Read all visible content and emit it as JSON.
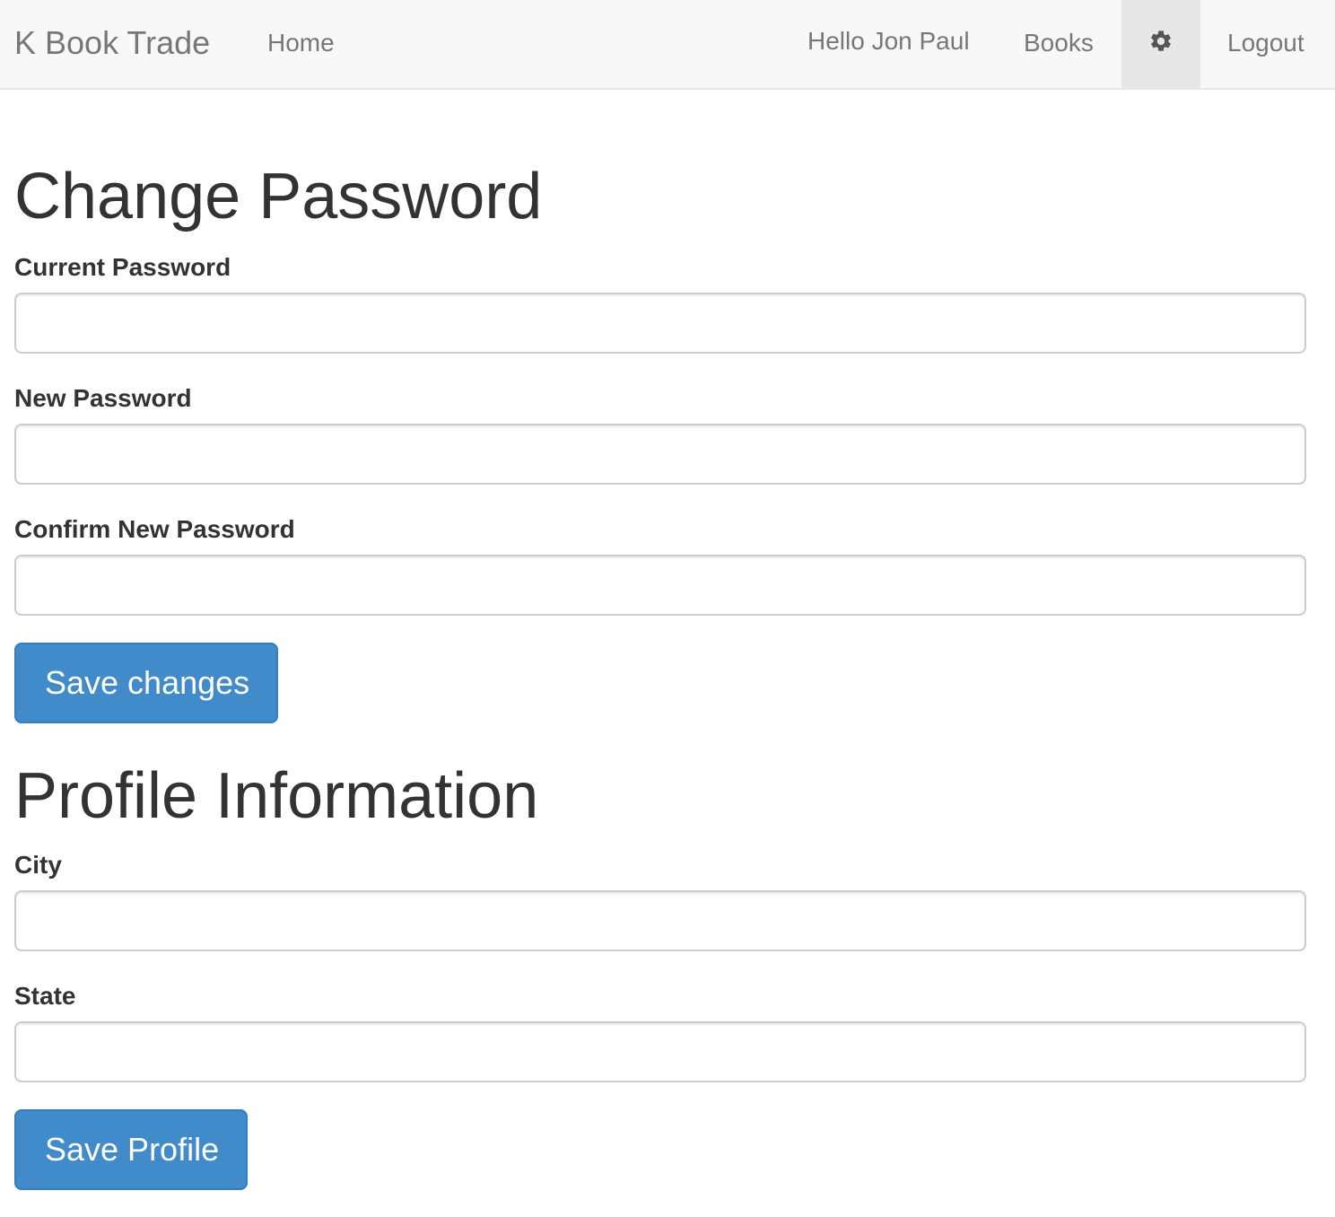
{
  "navbar": {
    "brand": "K Book Trade",
    "home": "Home",
    "greeting": "Hello Jon Paul",
    "books": "Books",
    "settings_icon": "gear-icon",
    "logout": "Logout"
  },
  "password_section": {
    "title": "Change Password",
    "current_label": "Current Password",
    "current_value": "",
    "new_label": "New Password",
    "new_value": "",
    "confirm_label": "Confirm New Password",
    "confirm_value": "",
    "save_label": "Save changes"
  },
  "profile_section": {
    "title": "Profile Information",
    "city_label": "City",
    "city_value": "",
    "state_label": "State",
    "state_value": "",
    "save_label": "Save Profile"
  },
  "colors": {
    "navbar_bg": "#f8f8f8",
    "active_nav_bg": "#e7e7e7",
    "primary_button": "#428bca",
    "text": "#333333",
    "nav_text": "#777777"
  }
}
